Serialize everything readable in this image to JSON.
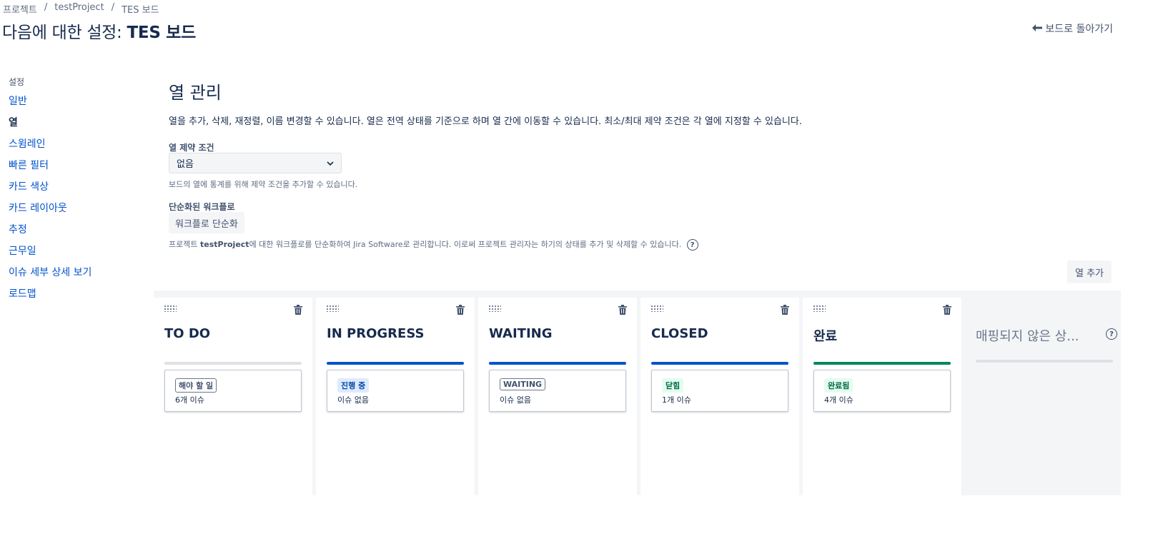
{
  "breadcrumb": [
    "프로젝트",
    "testProject",
    "TES 보드"
  ],
  "header": {
    "title_prefix": "다음에 대한 설정: ",
    "title_board": "TES 보드",
    "back_label": "보드로 돌아가기"
  },
  "sidebar": {
    "group": "설정",
    "items": [
      {
        "label": "일반",
        "active": false
      },
      {
        "label": "열",
        "active": true
      },
      {
        "label": "스윔레인",
        "active": false
      },
      {
        "label": "빠른 필터",
        "active": false
      },
      {
        "label": "카드 색상",
        "active": false
      },
      {
        "label": "카드 레이아웃",
        "active": false
      },
      {
        "label": "추정",
        "active": false
      },
      {
        "label": "근무일",
        "active": false
      },
      {
        "label": "이슈 세부 상세 보기",
        "active": false
      },
      {
        "label": "로드맵",
        "active": false
      }
    ]
  },
  "main": {
    "heading": "열 관리",
    "description": "열을 추가, 삭제, 재정렬, 이름 변경할 수 있습니다. 열은 전역 상태를 기준으로 하며 열 간에 이동할 수 있습니다. 최소/최대 제약 조건은 각 열에 지정할 수 있습니다.",
    "constraint_label": "열 제약 조건",
    "constraint_value": "없음",
    "constraint_hint": "보드의 열에 통계를 위해 제약 조건을 추가할 수 있습니다.",
    "simplified_label": "단순화된 워크플로",
    "simplify_button": "워크플로 단순화",
    "simplify_hint_pre": "프로젝트 ",
    "simplify_hint_project": "testProject",
    "simplify_hint_post": "에 대한 워크플로를 단순화하여 Jira Software로 관리합니다. 이로써 프로젝트 관리자는 하기의 상태를 추가 및 삭제할 수 있습니다.",
    "help_glyph": "?",
    "add_column": "열 추가"
  },
  "columns": [
    {
      "title": "TO DO",
      "bar_color": "#dfe1e6",
      "status": "해야 할 일",
      "status_color": "#42526e",
      "status_bg": "#ffffff",
      "count": "6개 이슈"
    },
    {
      "title": "IN PROGRESS",
      "bar_color": "#0052cc",
      "status": "진행 중",
      "status_color": "#0747a6",
      "status_bg": "#deebff",
      "count": "이슈 없음"
    },
    {
      "title": "WAITING",
      "bar_color": "#0052cc",
      "status": "WAITING",
      "status_color": "#42526e",
      "status_bg": "#ffffff",
      "count": "이슈 없음"
    },
    {
      "title": "CLOSED",
      "bar_color": "#0052cc",
      "status": "닫힘",
      "status_color": "#006644",
      "status_bg": "#e3fcef",
      "count": "1개 이슈"
    },
    {
      "title": "완료",
      "bar_color": "#00875a",
      "status": "완료됨",
      "status_color": "#006644",
      "status_bg": "#e3fcef",
      "count": "4개 이슈"
    }
  ],
  "unmapped": {
    "title": "매핑되지 않은 상...",
    "help_glyph": "?"
  }
}
